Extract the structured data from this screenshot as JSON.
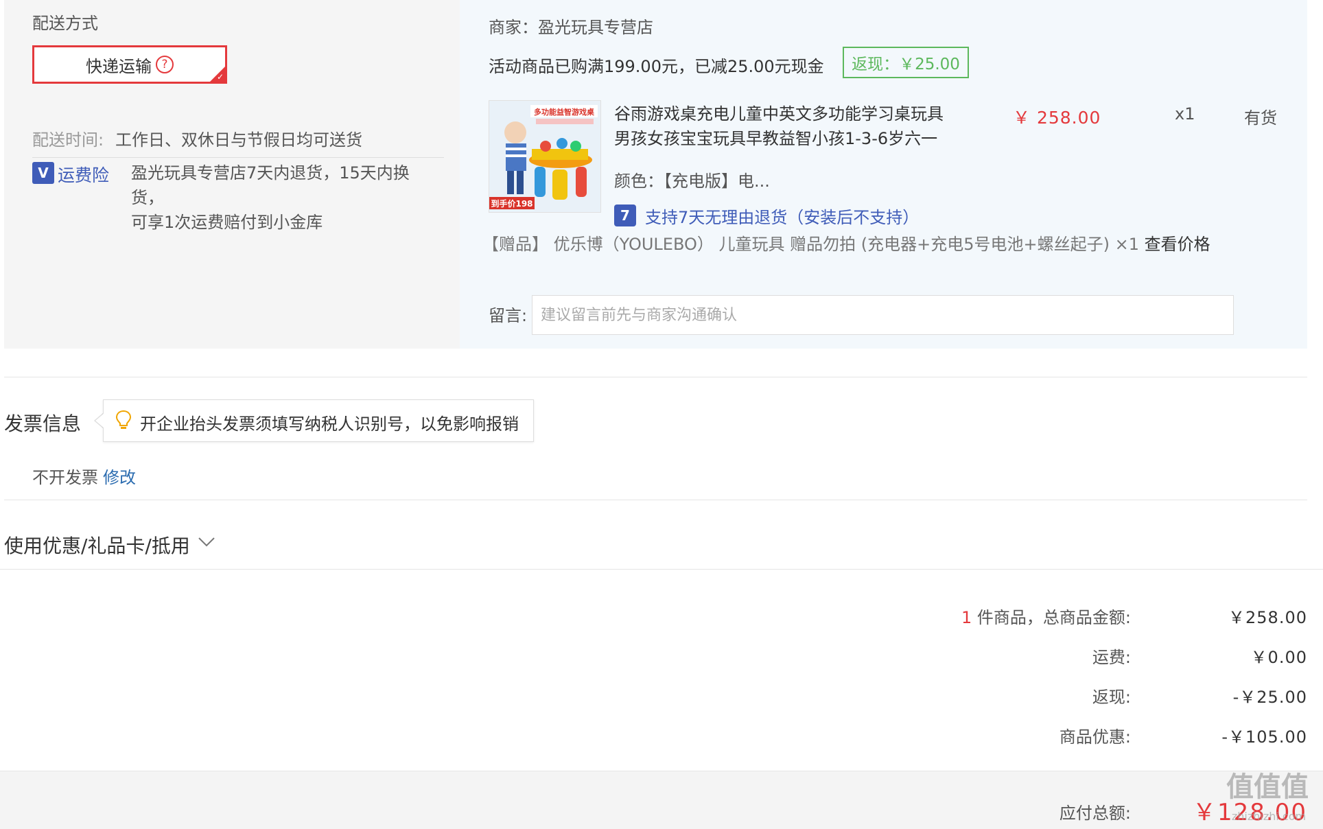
{
  "delivery": {
    "section_title": "配送方式",
    "method": "快递运输",
    "time_label": "配送时间:",
    "time_value": "工作日、双休日与节假日均可送货",
    "insurance_label": "运费险",
    "insurance_line1": "盈光玩具专营店7天内退货，15天内换货，",
    "insurance_line2": "可享1次运费赔付到小金库"
  },
  "order": {
    "merchant": "商家：盈光玩具专营店",
    "promo": "活动商品已购满199.00元，已减25.00元现金",
    "cashback": "返现：￥25.00",
    "product_image_caption": "多功能益智游戏桌",
    "product_image_price": "到手价198",
    "product_title_line1": "谷雨游戏桌充电儿童中英文多功能学习桌玩具",
    "product_title_line2": "男孩女孩宝宝玩具早教益智小孩1-3-6岁六一",
    "price": "￥ 258.00",
    "quantity": "x1",
    "stock": "有货",
    "color": "颜色：【充电版】电...",
    "return_policy_badge": "7",
    "return_policy": "支持7天无理由退货（安装后不支持）",
    "gift": "【赠品】 优乐博（YOULEBO） 儿童玩具 赠品勿拍 (充电器+充电5号电池+螺丝起子) ×1",
    "gift_price_link": "查看价格",
    "memo_label": "留言:",
    "memo_placeholder": "建议留言前先与商家沟通确认"
  },
  "invoice": {
    "title": "发票信息",
    "tip": "开企业抬头发票须填写纳税人识别号，以免影响报销",
    "status": "不开发票",
    "edit": "修改"
  },
  "coupon": {
    "title": "使用优惠/礼品卡/抵用"
  },
  "summary": {
    "count": "1",
    "items_label": " 件商品，总商品金额:",
    "items_value": "￥258.00",
    "shipping_label": "运费:",
    "shipping_value": "￥0.00",
    "cashback_label": "返现:",
    "cashback_value": "-￥25.00",
    "discount_label": "商品优惠:",
    "discount_value": "-￥105.00",
    "total_label": "应付总额:",
    "total_value": "￥128.00"
  },
  "watermark": {
    "logo": "值值值",
    "site": "zhizhizhi.com"
  },
  "colors": {
    "accent_red": "#e4393c",
    "cashback_green": "#5cb85c",
    "link_blue": "#2b6cb0",
    "badge_blue": "#3f5cb8"
  }
}
